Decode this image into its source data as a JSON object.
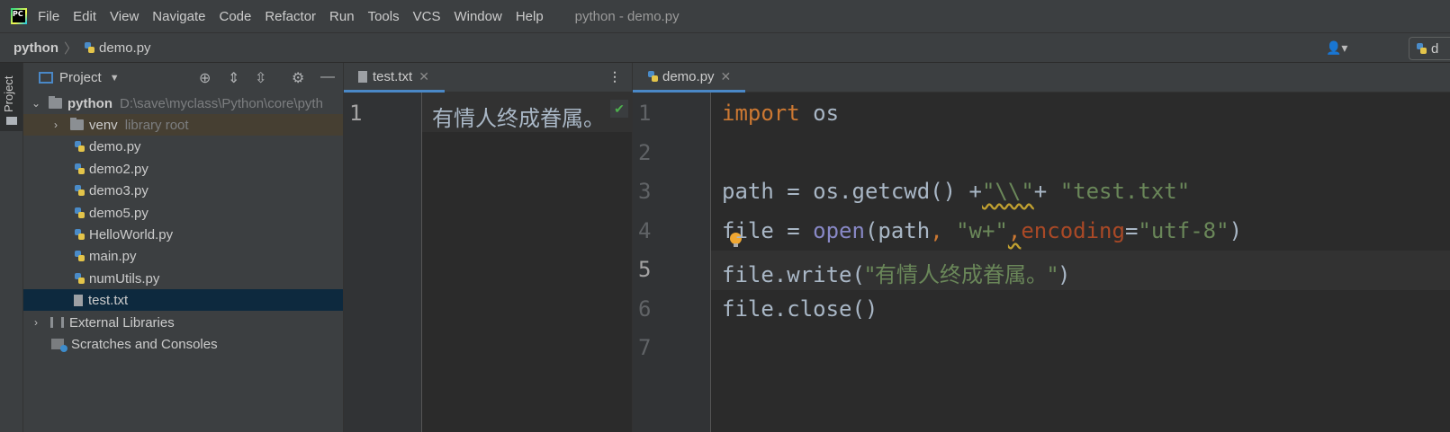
{
  "menubar": {
    "items": [
      "File",
      "Edit",
      "View",
      "Navigate",
      "Code",
      "Refactor",
      "Run",
      "Tools",
      "VCS",
      "Window",
      "Help"
    ],
    "title": "python - demo.py"
  },
  "navbar": {
    "root": "python",
    "file": "demo.py",
    "run_config_label": "d"
  },
  "sidestrip": {
    "tab_label": "Project"
  },
  "project": {
    "title": "Project",
    "root_name": "python",
    "root_path": "D:\\save\\myclass\\Python\\core\\pyth",
    "venv_name": "venv",
    "venv_hint": "library root",
    "files": [
      "demo.py",
      "demo2.py",
      "demo3.py",
      "demo5.py",
      "HelloWorld.py",
      "main.py",
      "numUtils.py",
      "test.txt"
    ],
    "external_libraries": "External Libraries",
    "scratches": "Scratches and Consoles"
  },
  "editor_left": {
    "tab_label": "test.txt",
    "line_numbers": [
      "1"
    ],
    "content": "有情人终成眷属。"
  },
  "editor_right": {
    "tab_label": "demo.py",
    "line_numbers": [
      "1",
      "2",
      "3",
      "4",
      "5",
      "6",
      "7"
    ],
    "code": {
      "l1_kw": "import",
      "l1_rest": " os",
      "l3_a": "path = os.getcwd() +",
      "l3_s1": "\"\\\\\"",
      "l3_b": "+ ",
      "l3_s2": "\"test.txt\"",
      "l4_a": "file = ",
      "l4_builtin": "open",
      "l4_b": "(path",
      "l4_comma1": ",",
      "l4_c": " ",
      "l4_s1": "\"w+\"",
      "l4_comma2": ",",
      "l4_param": "encoding",
      "l4_d": "=",
      "l4_s2": "\"utf-8\"",
      "l4_e": ")",
      "l5_a": "file.write(",
      "l5_s": "\"有情人终成眷属。\"",
      "l5_b": ")",
      "l6": "file.close()"
    }
  },
  "colors": {
    "keyword": "#cc7832",
    "string": "#6a8759",
    "builtin": "#8888c6",
    "param": "#aa4926",
    "text": "#a9b7c6",
    "selection": "#0d293e"
  }
}
